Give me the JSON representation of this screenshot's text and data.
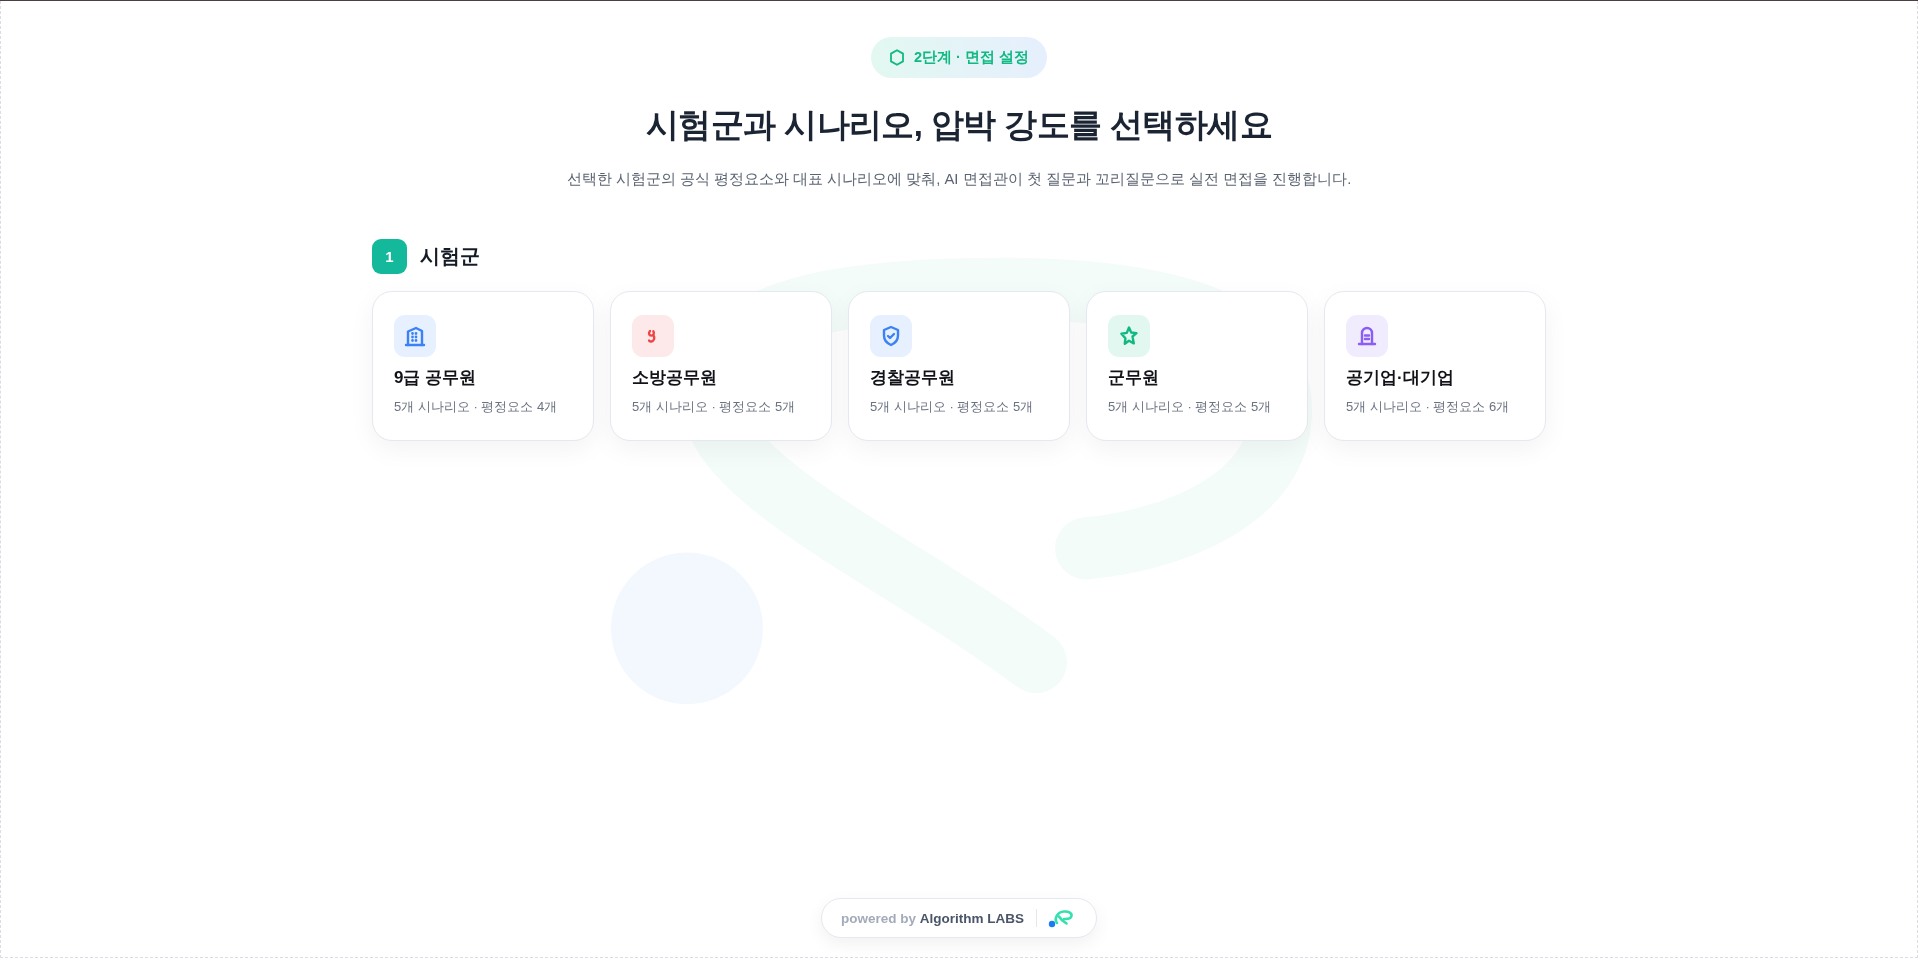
{
  "badge": {
    "label": "2단계 · 면접 설정"
  },
  "title": "시험군과 시나리오, 압박 강도를 선택하세요",
  "subtitle": "선택한 시험군의 공식 평정요소와 대표 시나리오에 맞춰, AI 면접관이 첫 질문과 꼬리질문으로 실전 면접을 진행합니다.",
  "section": {
    "number": "1",
    "label": "시험군"
  },
  "groups": [
    {
      "kind": "building",
      "color": "#3b82f6",
      "name": "9급 공무원",
      "meta": "5개 시나리오 · 평정요소 4개",
      "selected": false
    },
    {
      "kind": "curl",
      "color": "#ef4444",
      "name": "소방공무원",
      "meta": "5개 시나리오 · 평정요소 5개",
      "selected": false
    },
    {
      "kind": "shield",
      "color": "#3b82f6",
      "name": "경찰공무원",
      "meta": "5개 시나리오 · 평정요소 5개",
      "selected": false
    },
    {
      "kind": "star",
      "color": "#10b981",
      "name": "군무원",
      "meta": "5개 시나리오 · 평정요소 5개",
      "selected": false
    },
    {
      "kind": "landmark",
      "color": "#8b5cf6",
      "name": "공기업·대기업",
      "meta": "5개 시나리오 · 평정요소 6개",
      "selected": false
    }
  ],
  "footer": {
    "credit": "powered by **Algorithm LABS**"
  }
}
